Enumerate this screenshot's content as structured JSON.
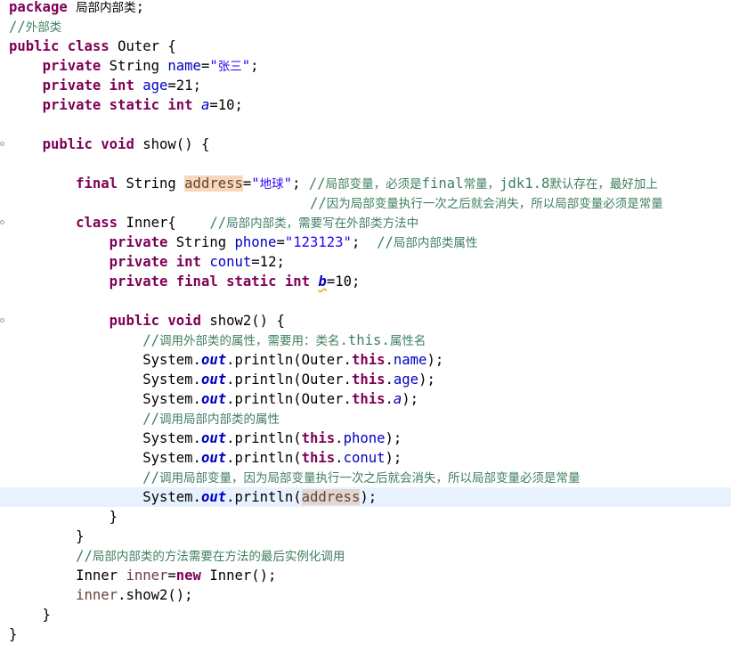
{
  "editor": {
    "lines": [
      {
        "segs": [
          {
            "t": "package",
            "c": "kw"
          },
          {
            "t": " "
          },
          {
            "t": "局部内部类",
            "c": "cn"
          },
          {
            "t": ";"
          }
        ]
      },
      {
        "segs": [
          {
            "t": "//",
            "c": "cm"
          },
          {
            "t": "外部类",
            "c": "cm cn"
          }
        ]
      },
      {
        "segs": [
          {
            "t": "public",
            "c": "kw"
          },
          {
            "t": " "
          },
          {
            "t": "class",
            "c": "kw"
          },
          {
            "t": " Outer {"
          }
        ]
      },
      {
        "segs": [
          {
            "t": "    "
          },
          {
            "t": "private",
            "c": "kw"
          },
          {
            "t": " String "
          },
          {
            "t": "name",
            "c": "field"
          },
          {
            "t": "="
          },
          {
            "t": "\"",
            "c": "str"
          },
          {
            "t": "张三",
            "c": "str cn"
          },
          {
            "t": "\"",
            "c": "str"
          },
          {
            "t": ";"
          }
        ]
      },
      {
        "segs": [
          {
            "t": "    "
          },
          {
            "t": "private",
            "c": "kw"
          },
          {
            "t": " "
          },
          {
            "t": "int",
            "c": "kw"
          },
          {
            "t": " "
          },
          {
            "t": "age",
            "c": "field"
          },
          {
            "t": "=21;"
          }
        ]
      },
      {
        "segs": [
          {
            "t": "    "
          },
          {
            "t": "private",
            "c": "kw"
          },
          {
            "t": " "
          },
          {
            "t": "static",
            "c": "kw"
          },
          {
            "t": " "
          },
          {
            "t": "int",
            "c": "kw"
          },
          {
            "t": " "
          },
          {
            "t": "a",
            "c": "sfield"
          },
          {
            "t": "=10;"
          }
        ]
      },
      {
        "segs": []
      },
      {
        "fold": true,
        "segs": [
          {
            "t": "    "
          },
          {
            "t": "public",
            "c": "kw"
          },
          {
            "t": " "
          },
          {
            "t": "void",
            "c": "kw"
          },
          {
            "t": " show() {"
          }
        ]
      },
      {
        "segs": []
      },
      {
        "segs": [
          {
            "t": "        "
          },
          {
            "t": "final",
            "c": "kw"
          },
          {
            "t": " String "
          },
          {
            "t": "address",
            "c": "local occ-hl"
          },
          {
            "t": "="
          },
          {
            "t": "\"",
            "c": "str"
          },
          {
            "t": "地球",
            "c": "str cn"
          },
          {
            "t": "\"",
            "c": "str"
          },
          {
            "t": "; "
          },
          {
            "t": "//",
            "c": "cm"
          },
          {
            "t": "局部变量，必须是",
            "c": "cm cn"
          },
          {
            "t": "final",
            "c": "cm"
          },
          {
            "t": "常量，",
            "c": "cm cn"
          },
          {
            "t": "jdk1.8",
            "c": "cm"
          },
          {
            "t": "默认存在，最好加上",
            "c": "cm cn"
          }
        ]
      },
      {
        "segs": [
          {
            "t": "                                    "
          },
          {
            "t": "//",
            "c": "cm"
          },
          {
            "t": "因为局部变量执行一次之后就会消失，所以局部变量必须是常量",
            "c": "cm cn"
          }
        ]
      },
      {
        "fold": true,
        "segs": [
          {
            "t": "        "
          },
          {
            "t": "class",
            "c": "kw"
          },
          {
            "t": " Inner{    "
          },
          {
            "t": "//",
            "c": "cm"
          },
          {
            "t": "局部内部类，需要写在外部类方法中",
            "c": "cm cn"
          }
        ]
      },
      {
        "segs": [
          {
            "t": "            "
          },
          {
            "t": "private",
            "c": "kw"
          },
          {
            "t": " String "
          },
          {
            "t": "phone",
            "c": "field"
          },
          {
            "t": "="
          },
          {
            "t": "\"123123\"",
            "c": "str"
          },
          {
            "t": ";  "
          },
          {
            "t": "//",
            "c": "cm"
          },
          {
            "t": "局部内部类属性",
            "c": "cm cn"
          }
        ]
      },
      {
        "segs": [
          {
            "t": "            "
          },
          {
            "t": "private",
            "c": "kw"
          },
          {
            "t": " "
          },
          {
            "t": "int",
            "c": "kw"
          },
          {
            "t": " "
          },
          {
            "t": "conut",
            "c": "field"
          },
          {
            "t": "=12;"
          }
        ]
      },
      {
        "segs": [
          {
            "t": "            "
          },
          {
            "t": "private",
            "c": "kw"
          },
          {
            "t": " "
          },
          {
            "t": "final",
            "c": "kw"
          },
          {
            "t": " "
          },
          {
            "t": "static",
            "c": "kw"
          },
          {
            "t": " "
          },
          {
            "t": "int",
            "c": "kw"
          },
          {
            "t": " "
          },
          {
            "t": "b",
            "c": "sfieldb squiggle"
          },
          {
            "t": "=10;"
          }
        ]
      },
      {
        "segs": []
      },
      {
        "fold": true,
        "segs": [
          {
            "t": "            "
          },
          {
            "t": "public",
            "c": "kw"
          },
          {
            "t": " "
          },
          {
            "t": "void",
            "c": "kw"
          },
          {
            "t": " show2() {"
          }
        ]
      },
      {
        "segs": [
          {
            "t": "                "
          },
          {
            "t": "//",
            "c": "cm"
          },
          {
            "t": "调用外部类的属性，需要用：类名",
            "c": "cm cn"
          },
          {
            "t": ".this.",
            "c": "cm"
          },
          {
            "t": "属性名",
            "c": "cm cn"
          }
        ]
      },
      {
        "segs": [
          {
            "t": "                System."
          },
          {
            "t": "out",
            "c": "sfieldb"
          },
          {
            "t": ".println(Outer."
          },
          {
            "t": "this",
            "c": "kw"
          },
          {
            "t": "."
          },
          {
            "t": "name",
            "c": "field"
          },
          {
            "t": ");"
          }
        ]
      },
      {
        "segs": [
          {
            "t": "                System."
          },
          {
            "t": "out",
            "c": "sfieldb"
          },
          {
            "t": ".println(Outer."
          },
          {
            "t": "this",
            "c": "kw"
          },
          {
            "t": "."
          },
          {
            "t": "age",
            "c": "field"
          },
          {
            "t": ");"
          }
        ]
      },
      {
        "segs": [
          {
            "t": "                System."
          },
          {
            "t": "out",
            "c": "sfieldb"
          },
          {
            "t": ".println(Outer."
          },
          {
            "t": "this",
            "c": "kw"
          },
          {
            "t": "."
          },
          {
            "t": "a",
            "c": "sfield"
          },
          {
            "t": ");"
          }
        ]
      },
      {
        "segs": [
          {
            "t": "                "
          },
          {
            "t": "//",
            "c": "cm"
          },
          {
            "t": "调用局部内部类的属性",
            "c": "cm cn"
          }
        ]
      },
      {
        "segs": [
          {
            "t": "                System."
          },
          {
            "t": "out",
            "c": "sfieldb"
          },
          {
            "t": ".println("
          },
          {
            "t": "this",
            "c": "kw"
          },
          {
            "t": "."
          },
          {
            "t": "phone",
            "c": "field"
          },
          {
            "t": ");"
          }
        ]
      },
      {
        "segs": [
          {
            "t": "                System."
          },
          {
            "t": "out",
            "c": "sfieldb"
          },
          {
            "t": ".println("
          },
          {
            "t": "this",
            "c": "kw"
          },
          {
            "t": "."
          },
          {
            "t": "conut",
            "c": "field"
          },
          {
            "t": ");"
          }
        ]
      },
      {
        "segs": [
          {
            "t": "                "
          },
          {
            "t": "//",
            "c": "cm"
          },
          {
            "t": "调用局部变量，因为局部变量执行一次之后就会消失，所以局部变量必须是常量",
            "c": "cm cn"
          }
        ]
      },
      {
        "current": true,
        "segs": [
          {
            "t": "                System."
          },
          {
            "t": "out",
            "c": "sfieldb"
          },
          {
            "t": ".println("
          },
          {
            "t": "address",
            "c": "local occ-read"
          },
          {
            "t": ");"
          }
        ]
      },
      {
        "segs": [
          {
            "t": "            }"
          }
        ]
      },
      {
        "segs": [
          {
            "t": "        }"
          }
        ]
      },
      {
        "segs": [
          {
            "t": "        "
          },
          {
            "t": "//",
            "c": "cm"
          },
          {
            "t": "局部内部类的方法需要在方法的最后实例化调用",
            "c": "cm cn"
          }
        ]
      },
      {
        "segs": [
          {
            "t": "        Inner "
          },
          {
            "t": "inner",
            "c": "local"
          },
          {
            "t": "="
          },
          {
            "t": "new",
            "c": "kw"
          },
          {
            "t": " Inner();"
          }
        ]
      },
      {
        "segs": [
          {
            "t": "        "
          },
          {
            "t": "inner",
            "c": "local"
          },
          {
            "t": ".show2();"
          }
        ]
      },
      {
        "segs": [
          {
            "t": "    }"
          }
        ]
      },
      {
        "segs": [
          {
            "t": "}"
          }
        ]
      }
    ]
  }
}
